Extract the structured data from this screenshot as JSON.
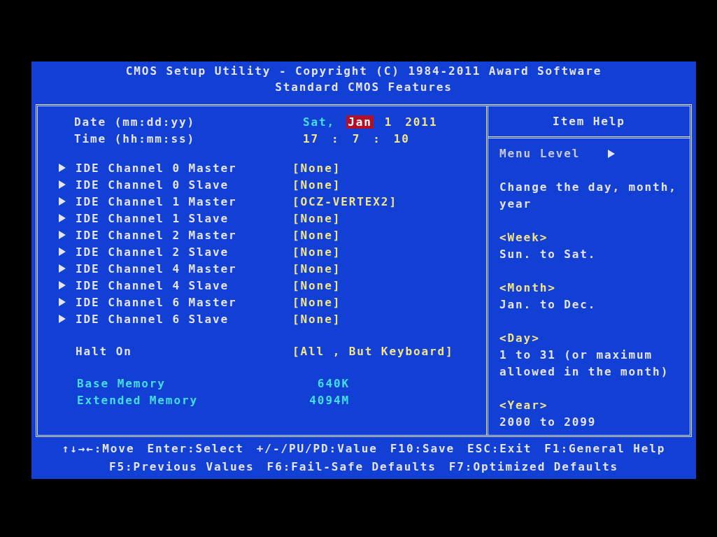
{
  "header": {
    "title": "CMOS Setup Utility - Copyright (C) 1984-2011 Award Software",
    "subtitle": "Standard CMOS Features"
  },
  "date": {
    "label": "Date (mm:dd:yy)",
    "parts": [
      {
        "text": "Sat,",
        "kind": "weekday",
        "selected": false
      },
      {
        "text": "Jan",
        "kind": "field",
        "selected": true
      },
      {
        "text": "1",
        "kind": "field",
        "selected": false
      },
      {
        "text": "2011",
        "kind": "field",
        "selected": false
      }
    ]
  },
  "time": {
    "label": "Time (hh:mm:ss)",
    "parts": [
      "17",
      ":",
      "7",
      ":",
      "10"
    ]
  },
  "devices": [
    {
      "label": "IDE Channel 0 Master",
      "value": "[None]"
    },
    {
      "label": "IDE Channel 0 Slave",
      "value": "[None]"
    },
    {
      "label": "IDE Channel 1 Master",
      "value": "[OCZ-VERTEX2]"
    },
    {
      "label": "IDE Channel 1 Slave",
      "value": "[None]"
    },
    {
      "label": "IDE Channel 2 Master",
      "value": "[None]"
    },
    {
      "label": "IDE Channel 2 Slave",
      "value": "[None]"
    },
    {
      "label": "IDE Channel 4 Master",
      "value": "[None]"
    },
    {
      "label": "IDE Channel 4 Slave",
      "value": "[None]"
    },
    {
      "label": "IDE Channel 6 Master",
      "value": "[None]"
    },
    {
      "label": "IDE Channel 6 Slave",
      "value": "[None]"
    }
  ],
  "halt_on": {
    "label": "Halt On",
    "value": "[All , But Keyboard]"
  },
  "memory": [
    {
      "label": "Base Memory",
      "value": "640K"
    },
    {
      "label": "Extended Memory",
      "value": "4094M"
    }
  ],
  "item_help": {
    "title": "Item Help",
    "menu_level": "Menu Level",
    "entries": [
      {
        "kind": "text",
        "text": "Change the day, month,\nyear"
      },
      {
        "kind": "heading",
        "text": "<Week>"
      },
      {
        "kind": "text",
        "text": "Sun. to Sat."
      },
      {
        "kind": "heading",
        "text": "<Month>"
      },
      {
        "kind": "text",
        "text": "Jan. to Dec."
      },
      {
        "kind": "heading",
        "text": "<Day>"
      },
      {
        "kind": "text",
        "text": "1 to 31 (or maximum\nallowed in the month)"
      },
      {
        "kind": "heading",
        "text": "<Year>"
      },
      {
        "kind": "text",
        "text": "2000 to 2099"
      }
    ]
  },
  "footer": [
    [
      "↑↓→←:Move",
      "Enter:Select",
      "+/-/PU/PD:Value",
      "F10:Save",
      "ESC:Exit",
      "F1:General Help"
    ],
    [
      "F5:Previous Values",
      "F6:Fail-Safe Defaults",
      "F7:Optimized Defaults"
    ]
  ]
}
